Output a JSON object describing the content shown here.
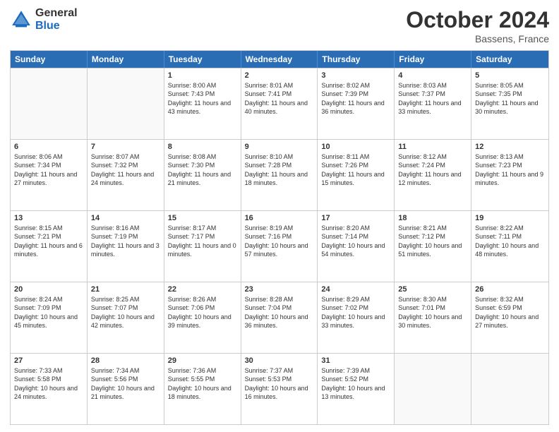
{
  "logo": {
    "general": "General",
    "blue": "Blue"
  },
  "title": "October 2024",
  "location": "Bassens, France",
  "days": [
    "Sunday",
    "Monday",
    "Tuesday",
    "Wednesday",
    "Thursday",
    "Friday",
    "Saturday"
  ],
  "weeks": [
    [
      {
        "day": "",
        "sunrise": "",
        "sunset": "",
        "daylight": "",
        "empty": true
      },
      {
        "day": "",
        "sunrise": "",
        "sunset": "",
        "daylight": "",
        "empty": true
      },
      {
        "day": "1",
        "sunrise": "Sunrise: 8:00 AM",
        "sunset": "Sunset: 7:43 PM",
        "daylight": "Daylight: 11 hours and 43 minutes."
      },
      {
        "day": "2",
        "sunrise": "Sunrise: 8:01 AM",
        "sunset": "Sunset: 7:41 PM",
        "daylight": "Daylight: 11 hours and 40 minutes."
      },
      {
        "day": "3",
        "sunrise": "Sunrise: 8:02 AM",
        "sunset": "Sunset: 7:39 PM",
        "daylight": "Daylight: 11 hours and 36 minutes."
      },
      {
        "day": "4",
        "sunrise": "Sunrise: 8:03 AM",
        "sunset": "Sunset: 7:37 PM",
        "daylight": "Daylight: 11 hours and 33 minutes."
      },
      {
        "day": "5",
        "sunrise": "Sunrise: 8:05 AM",
        "sunset": "Sunset: 7:35 PM",
        "daylight": "Daylight: 11 hours and 30 minutes."
      }
    ],
    [
      {
        "day": "6",
        "sunrise": "Sunrise: 8:06 AM",
        "sunset": "Sunset: 7:34 PM",
        "daylight": "Daylight: 11 hours and 27 minutes."
      },
      {
        "day": "7",
        "sunrise": "Sunrise: 8:07 AM",
        "sunset": "Sunset: 7:32 PM",
        "daylight": "Daylight: 11 hours and 24 minutes."
      },
      {
        "day": "8",
        "sunrise": "Sunrise: 8:08 AM",
        "sunset": "Sunset: 7:30 PM",
        "daylight": "Daylight: 11 hours and 21 minutes."
      },
      {
        "day": "9",
        "sunrise": "Sunrise: 8:10 AM",
        "sunset": "Sunset: 7:28 PM",
        "daylight": "Daylight: 11 hours and 18 minutes."
      },
      {
        "day": "10",
        "sunrise": "Sunrise: 8:11 AM",
        "sunset": "Sunset: 7:26 PM",
        "daylight": "Daylight: 11 hours and 15 minutes."
      },
      {
        "day": "11",
        "sunrise": "Sunrise: 8:12 AM",
        "sunset": "Sunset: 7:24 PM",
        "daylight": "Daylight: 11 hours and 12 minutes."
      },
      {
        "day": "12",
        "sunrise": "Sunrise: 8:13 AM",
        "sunset": "Sunset: 7:23 PM",
        "daylight": "Daylight: 11 hours and 9 minutes."
      }
    ],
    [
      {
        "day": "13",
        "sunrise": "Sunrise: 8:15 AM",
        "sunset": "Sunset: 7:21 PM",
        "daylight": "Daylight: 11 hours and 6 minutes."
      },
      {
        "day": "14",
        "sunrise": "Sunrise: 8:16 AM",
        "sunset": "Sunset: 7:19 PM",
        "daylight": "Daylight: 11 hours and 3 minutes."
      },
      {
        "day": "15",
        "sunrise": "Sunrise: 8:17 AM",
        "sunset": "Sunset: 7:17 PM",
        "daylight": "Daylight: 11 hours and 0 minutes."
      },
      {
        "day": "16",
        "sunrise": "Sunrise: 8:19 AM",
        "sunset": "Sunset: 7:16 PM",
        "daylight": "Daylight: 10 hours and 57 minutes."
      },
      {
        "day": "17",
        "sunrise": "Sunrise: 8:20 AM",
        "sunset": "Sunset: 7:14 PM",
        "daylight": "Daylight: 10 hours and 54 minutes."
      },
      {
        "day": "18",
        "sunrise": "Sunrise: 8:21 AM",
        "sunset": "Sunset: 7:12 PM",
        "daylight": "Daylight: 10 hours and 51 minutes."
      },
      {
        "day": "19",
        "sunrise": "Sunrise: 8:22 AM",
        "sunset": "Sunset: 7:11 PM",
        "daylight": "Daylight: 10 hours and 48 minutes."
      }
    ],
    [
      {
        "day": "20",
        "sunrise": "Sunrise: 8:24 AM",
        "sunset": "Sunset: 7:09 PM",
        "daylight": "Daylight: 10 hours and 45 minutes."
      },
      {
        "day": "21",
        "sunrise": "Sunrise: 8:25 AM",
        "sunset": "Sunset: 7:07 PM",
        "daylight": "Daylight: 10 hours and 42 minutes."
      },
      {
        "day": "22",
        "sunrise": "Sunrise: 8:26 AM",
        "sunset": "Sunset: 7:06 PM",
        "daylight": "Daylight: 10 hours and 39 minutes."
      },
      {
        "day": "23",
        "sunrise": "Sunrise: 8:28 AM",
        "sunset": "Sunset: 7:04 PM",
        "daylight": "Daylight: 10 hours and 36 minutes."
      },
      {
        "day": "24",
        "sunrise": "Sunrise: 8:29 AM",
        "sunset": "Sunset: 7:02 PM",
        "daylight": "Daylight: 10 hours and 33 minutes."
      },
      {
        "day": "25",
        "sunrise": "Sunrise: 8:30 AM",
        "sunset": "Sunset: 7:01 PM",
        "daylight": "Daylight: 10 hours and 30 minutes."
      },
      {
        "day": "26",
        "sunrise": "Sunrise: 8:32 AM",
        "sunset": "Sunset: 6:59 PM",
        "daylight": "Daylight: 10 hours and 27 minutes."
      }
    ],
    [
      {
        "day": "27",
        "sunrise": "Sunrise: 7:33 AM",
        "sunset": "Sunset: 5:58 PM",
        "daylight": "Daylight: 10 hours and 24 minutes."
      },
      {
        "day": "28",
        "sunrise": "Sunrise: 7:34 AM",
        "sunset": "Sunset: 5:56 PM",
        "daylight": "Daylight: 10 hours and 21 minutes."
      },
      {
        "day": "29",
        "sunrise": "Sunrise: 7:36 AM",
        "sunset": "Sunset: 5:55 PM",
        "daylight": "Daylight: 10 hours and 18 minutes."
      },
      {
        "day": "30",
        "sunrise": "Sunrise: 7:37 AM",
        "sunset": "Sunset: 5:53 PM",
        "daylight": "Daylight: 10 hours and 16 minutes."
      },
      {
        "day": "31",
        "sunrise": "Sunrise: 7:39 AM",
        "sunset": "Sunset: 5:52 PM",
        "daylight": "Daylight: 10 hours and 13 minutes."
      },
      {
        "day": "",
        "sunrise": "",
        "sunset": "",
        "daylight": "",
        "empty": true
      },
      {
        "day": "",
        "sunrise": "",
        "sunset": "",
        "daylight": "",
        "empty": true
      }
    ]
  ]
}
